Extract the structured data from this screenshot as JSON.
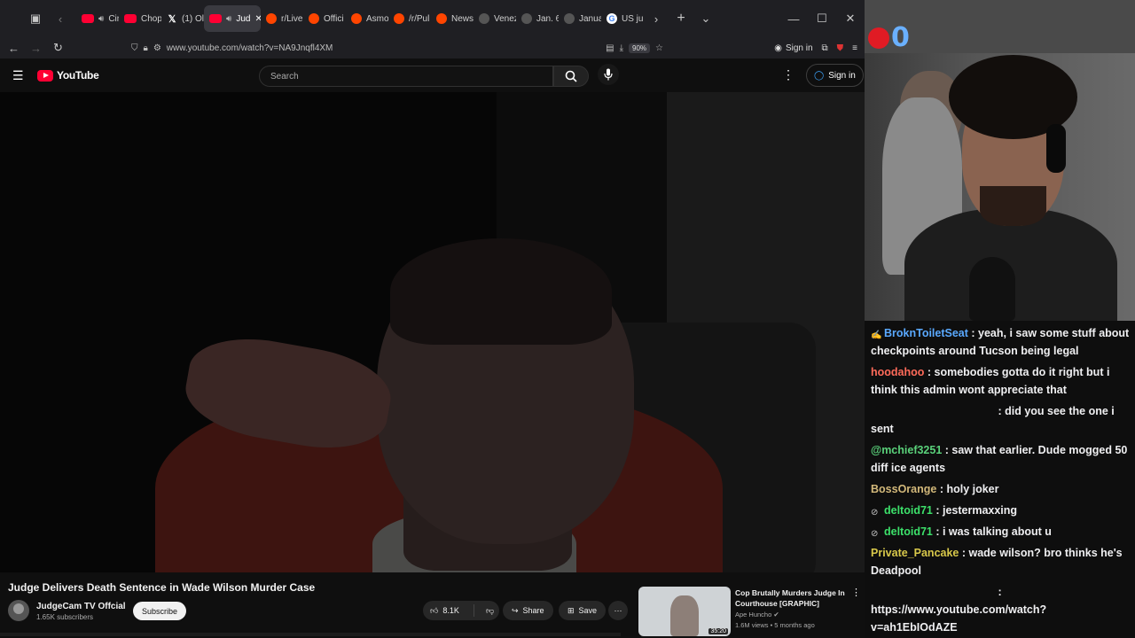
{
  "browser": {
    "tabs": [
      {
        "icon": "youtube-favicon",
        "label": "Cinem",
        "audio": true
      },
      {
        "icon": "youtube-favicon",
        "label": "Chop",
        "audio": false
      },
      {
        "icon": "x-favicon",
        "label": "(1) Ol",
        "audio": false
      },
      {
        "icon": "youtube-favicon",
        "label": "Jud",
        "audio": true,
        "active": true
      },
      {
        "icon": "reddit-favicon",
        "label": "r/Live",
        "audio": false
      },
      {
        "icon": "reddit-favicon",
        "label": "Offici",
        "audio": false
      },
      {
        "icon": "reddit-favicon",
        "label": "Asmo",
        "audio": false
      },
      {
        "icon": "reddit-favicon",
        "label": "/r/Pul",
        "audio": false
      },
      {
        "icon": "reddit-favicon",
        "label": "News",
        "audio": false
      },
      {
        "icon": "site-favicon",
        "label": "Venez",
        "audio": false
      },
      {
        "icon": "site-favicon",
        "label": "Jan. 6",
        "audio": false
      },
      {
        "icon": "site-favicon",
        "label": "Janua",
        "audio": false
      },
      {
        "icon": "google-favicon",
        "label": "US ju",
        "audio": false
      }
    ],
    "url": "www.youtube.com/watch?v=NA9Jnqfl4XM",
    "zoom": "90%",
    "sign_in": "Sign in"
  },
  "youtube": {
    "logo_text": "YouTube",
    "search_placeholder": "Search",
    "sign_in": "Sign in",
    "video": {
      "title": "Judge Delivers Death Sentence in Wade Wilson Murder Case",
      "channel": "JudgeCam TV Offcial",
      "subscribers": "1.65K subscribers",
      "subscribe_label": "Subscribe",
      "likes": "8.1K",
      "share_label": "Share",
      "save_label": "Save"
    },
    "recommended": {
      "title": "Cop Brutally Murders Judge In Courthouse [GRAPHIC]",
      "channel": "Ape Huncho",
      "meta": "1.6M views • 5 months ago",
      "duration": "35:20"
    }
  },
  "stream": {
    "viewer_count": "0",
    "chat": [
      {
        "user": "BroknToiletSeat",
        "color": "#5aa9ff",
        "badge": "hand-icon",
        "text": " : yeah, i saw some stuff about checkpoints around Tucson being legal"
      },
      {
        "user": "hoodahoo",
        "color": "#ff6b5a",
        "badge": "",
        "text": " : somebodies gotta do it right but i think this admin wont appreciate that"
      },
      {
        "user": "",
        "color": "#efeff1",
        "badge": "",
        "text": " : did you see the one i sent",
        "blank_name": true
      },
      {
        "user": "@mchief3251",
        "color": "#5ad17a",
        "badge": "",
        "text": " : saw that earlier. Dude mogged 50 diff ice agents"
      },
      {
        "user": "BossOrange",
        "color": "#d2b87a",
        "badge": "",
        "text": " : holy joker"
      },
      {
        "user": "deltoid71",
        "color": "#3ce06a",
        "badge": "mute-icon",
        "text": " : jestermaxxing"
      },
      {
        "user": "deltoid71",
        "color": "#3ce06a",
        "badge": "mute-icon",
        "text": " : i was talking about u"
      },
      {
        "user": "Private_Pancake",
        "color": "#d8c84a",
        "badge": "",
        "text": " : wade wilson? bro thinks he's Deadpool"
      },
      {
        "user": "",
        "color": "#efeff1",
        "badge": "",
        "text": " : https://www.youtube.com/watch?v=ah1EbIOdAZE",
        "blank_name": true
      }
    ]
  }
}
